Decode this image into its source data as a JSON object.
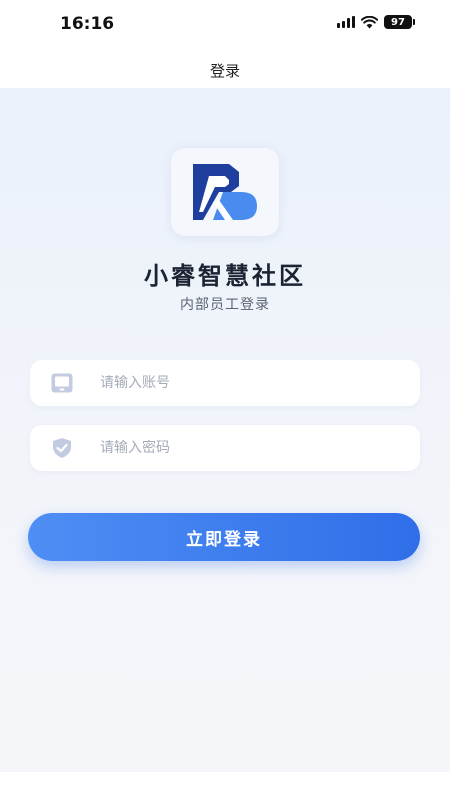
{
  "status_bar": {
    "time": "16:16",
    "battery": "97",
    "icons": [
      "signal-icon",
      "wifi-icon",
      "battery-icon"
    ]
  },
  "nav": {
    "title": "登录"
  },
  "app": {
    "name": "小睿智慧社区",
    "subtitle": "内部员工登录",
    "logo_icon": "brand-logo-icon"
  },
  "form": {
    "account_placeholder": "请输入账号",
    "account_value": "",
    "account_icon": "phone-icon",
    "password_placeholder": "请输入密码",
    "password_value": "",
    "password_icon": "shield-check-icon",
    "login_label": "立即登录"
  },
  "colors": {
    "accent": "#3576ea",
    "logo_dark": "#1f3f9e",
    "logo_light": "#4a8bf0",
    "icon_grey": "#c3cbe0",
    "title_text": "#1c2333",
    "subtitle_text": "#5b6274"
  }
}
